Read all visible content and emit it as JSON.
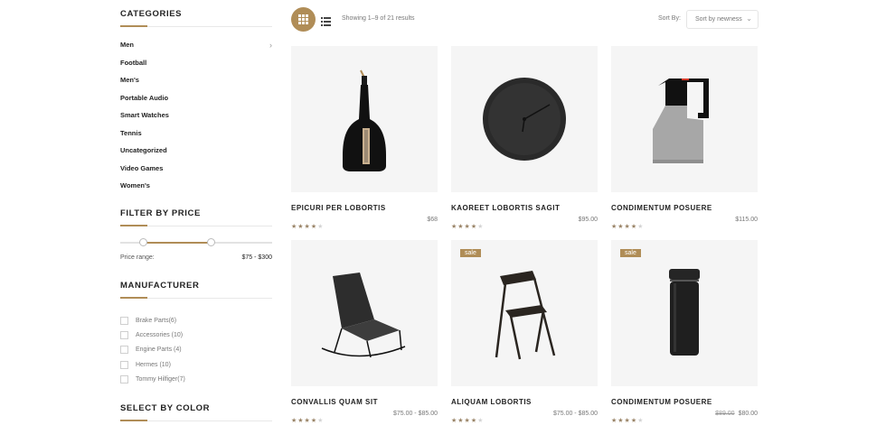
{
  "colors": {
    "accent": "#b08d57",
    "product_bg": "#f5f5f5",
    "star": "#9a8467"
  },
  "sidebar": {
    "categories": {
      "title": "CATEGORIES",
      "items": [
        "Men",
        "Football",
        "Men's",
        "Portable Audio",
        "Smart Watches",
        "Tennis",
        "Uncategorized",
        "Video Games",
        "Women's"
      ]
    },
    "filter": {
      "title": "FILTER BY PRICE",
      "range_label": "Price range:",
      "range_value": "$75 - $300"
    },
    "manufacturer": {
      "title": "MANUFACTURER",
      "items": [
        "Brake Parts(6)",
        "Accessories (10)",
        "Engine Parts (4)",
        "Hermes (10)",
        "Tommy Hilfiger(7)"
      ]
    },
    "color": {
      "title": "SELECT BY COLOR"
    }
  },
  "toolbar": {
    "grid_icon": "grid-icon",
    "list_icon": "list-icon",
    "result_count": "Showing 1–9 of 21 results",
    "sort_label": "Sort By:",
    "sort_value": "Sort by newness"
  },
  "products": [
    {
      "name": "EPICURI PER LOBORTIS",
      "price": "$68",
      "old_price": "",
      "sale": false,
      "rating": 4,
      "image": "bottle"
    },
    {
      "name": "KAOREET LOBORTIS SAGIT",
      "price": "$95.00",
      "old_price": "",
      "sale": false,
      "rating": 4,
      "image": "clock"
    },
    {
      "name": "CONDIMENTUM POSUERE",
      "price": "$115.00",
      "old_price": "",
      "sale": false,
      "rating": 4,
      "image": "jug"
    },
    {
      "name": "CONVALLIS QUAM SIT",
      "price": "$75.00 - $85.00",
      "old_price": "",
      "sale": false,
      "rating": 4,
      "image": "rocking-chair"
    },
    {
      "name": "ALIQUAM LOBORTIS",
      "price": "$75.00 - $85.00",
      "old_price": "",
      "sale": true,
      "sale_label": "sale",
      "rating": 4,
      "image": "chair"
    },
    {
      "name": "CONDIMENTUM POSUERE",
      "price": "$80.00",
      "old_price": "$89.00",
      "sale": true,
      "sale_label": "sale",
      "rating": 4,
      "image": "tumbler"
    }
  ]
}
